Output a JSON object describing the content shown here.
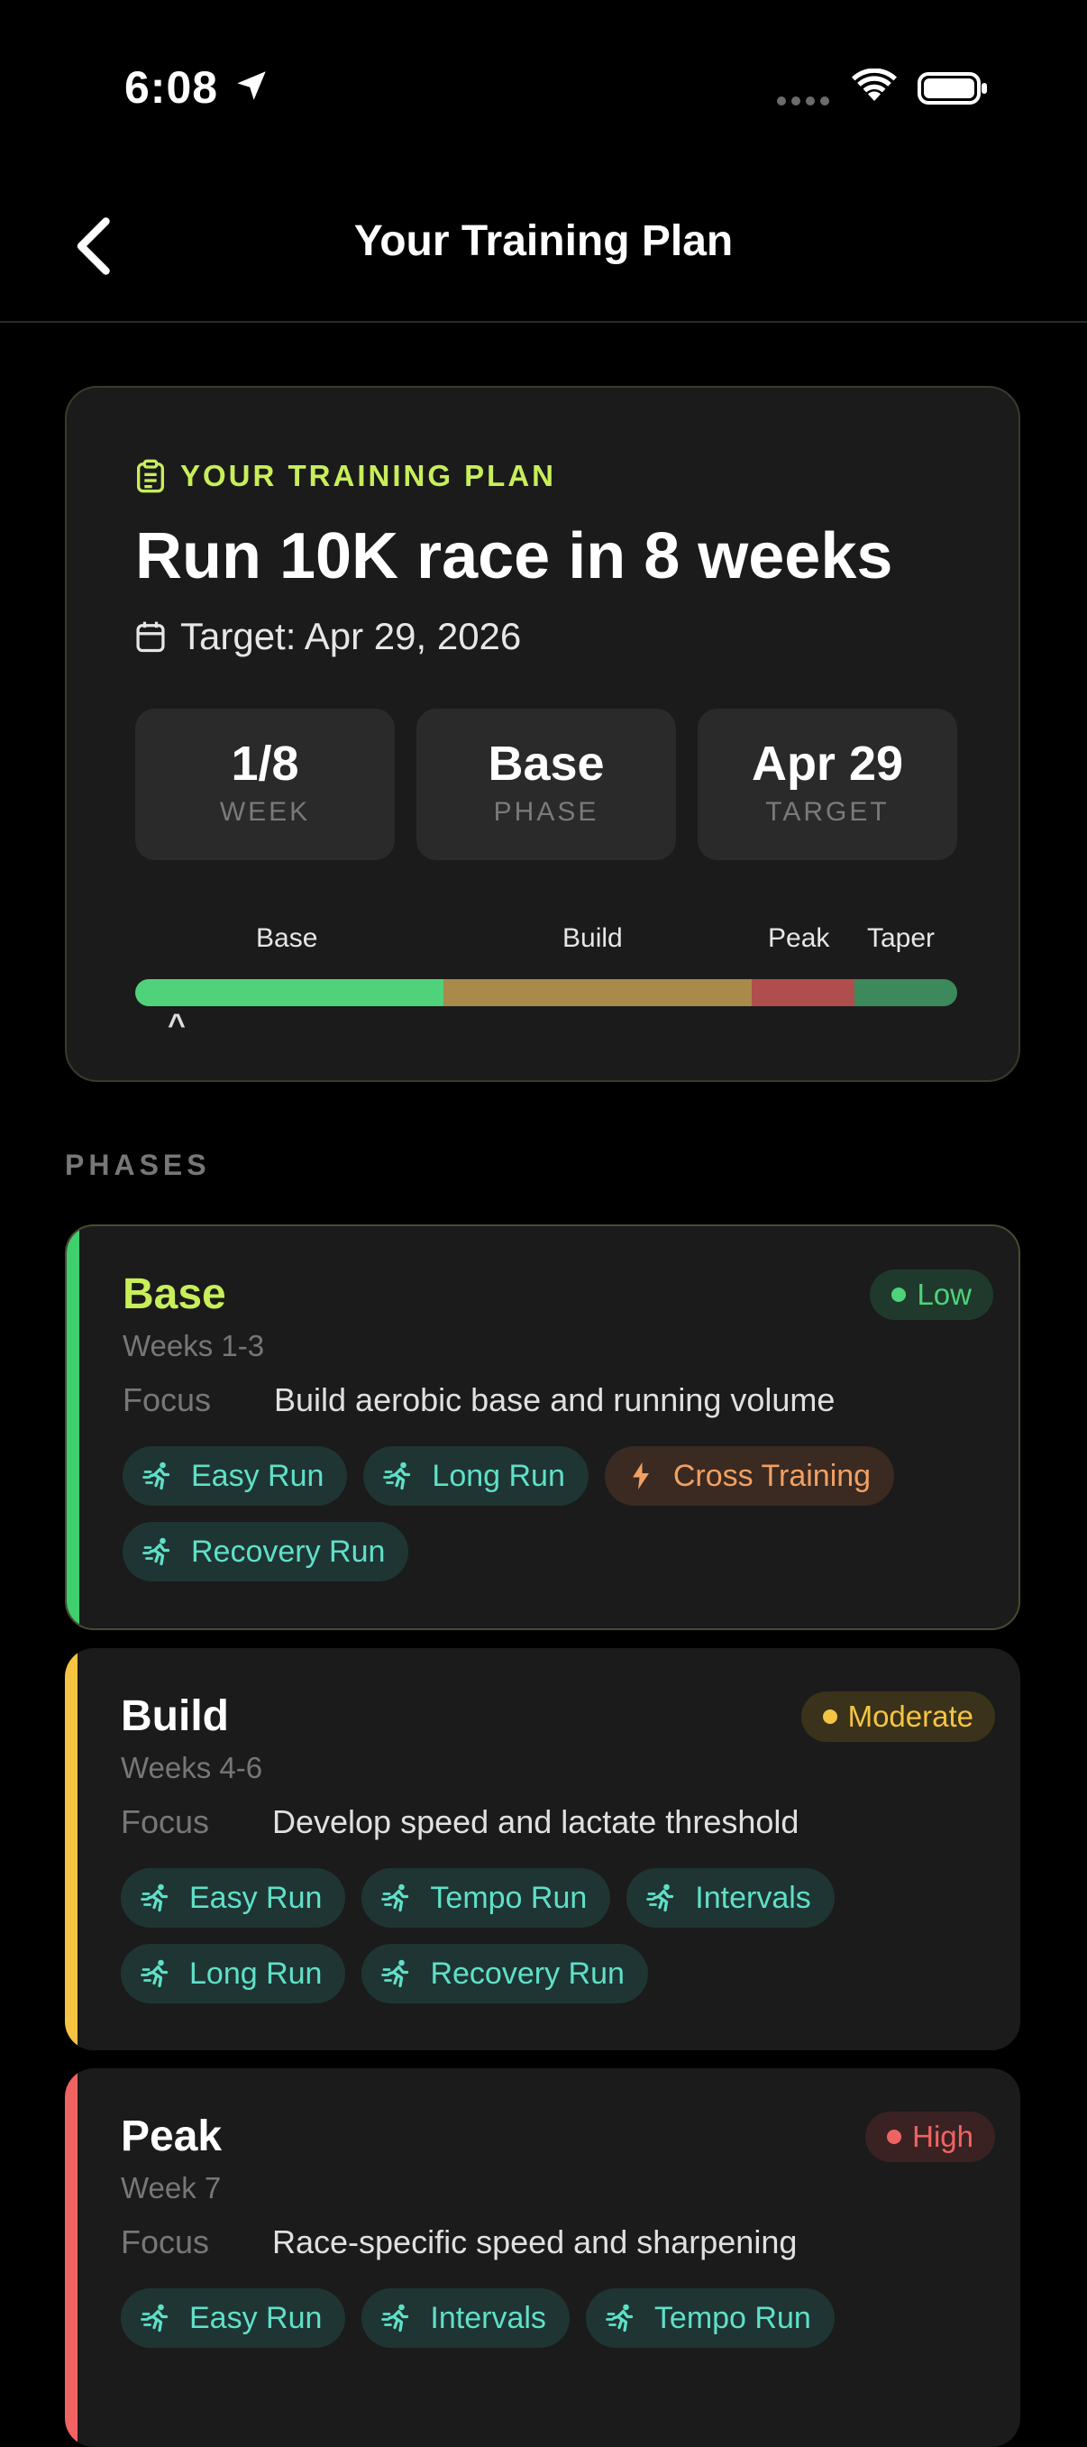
{
  "status_bar": {
    "time": "6:08"
  },
  "header": {
    "title": "Your Training Plan"
  },
  "plan": {
    "kicker": "YOUR TRAINING PLAN",
    "title": "Run 10K race in 8 weeks",
    "target": "Target: Apr 29, 2026",
    "stats": [
      {
        "value": "1/8",
        "label": "WEEK"
      },
      {
        "value": "Base",
        "label": "PHASE"
      },
      {
        "value": "Apr 29",
        "label": "TARGET"
      }
    ],
    "timeline": {
      "labels": [
        "Base",
        "Build",
        "Peak",
        "Taper"
      ],
      "week_fractions": [
        3,
        3,
        1,
        1
      ],
      "colors": [
        "#4fd27a",
        "#a88a4a",
        "#b04d4d",
        "#3c8a5c"
      ],
      "caret": "^"
    }
  },
  "section_label": "PHASES",
  "phases": [
    {
      "name": "Base",
      "name_color": "#c8ee5a",
      "weeks": "Weeks 1-3",
      "focus_label": "Focus",
      "focus": "Build aerobic base and running volume",
      "intensity": "Low",
      "intensity_color": "#4fd27a",
      "intensity_bg": "#1f3a2c",
      "stripe": "#3fcf6e",
      "tags": [
        {
          "label": "Easy Run",
          "icon": "running-icon"
        },
        {
          "label": "Long Run",
          "icon": "running-icon"
        },
        {
          "label": "Cross Training",
          "icon": "lightning-icon"
        },
        {
          "label": "Recovery Run",
          "icon": "running-icon"
        }
      ]
    },
    {
      "name": "Build",
      "name_color": "#ffffff",
      "weeks": "Weeks 4-6",
      "focus_label": "Focus",
      "focus": "Develop speed and lactate threshold",
      "intensity": "Moderate",
      "intensity_color": "#f5c443",
      "intensity_bg": "#3a321a",
      "stripe": "#f5c443",
      "tags": [
        {
          "label": "Easy Run",
          "icon": "running-icon"
        },
        {
          "label": "Tempo Run",
          "icon": "running-icon"
        },
        {
          "label": "Intervals",
          "icon": "running-icon"
        },
        {
          "label": "Long Run",
          "icon": "running-icon"
        },
        {
          "label": "Recovery Run",
          "icon": "running-icon"
        }
      ]
    },
    {
      "name": "Peak",
      "name_color": "#ffffff",
      "weeks": "Week 7",
      "focus_label": "Focus",
      "focus": "Race-specific speed and sharpening",
      "intensity": "High",
      "intensity_color": "#f06363",
      "intensity_bg": "#3a2222",
      "stripe": "#f06363",
      "tags": [
        {
          "label": "Easy Run",
          "icon": "running-icon"
        },
        {
          "label": "Intervals",
          "icon": "running-icon"
        },
        {
          "label": "Tempo Run",
          "icon": "running-icon"
        }
      ]
    }
  ]
}
